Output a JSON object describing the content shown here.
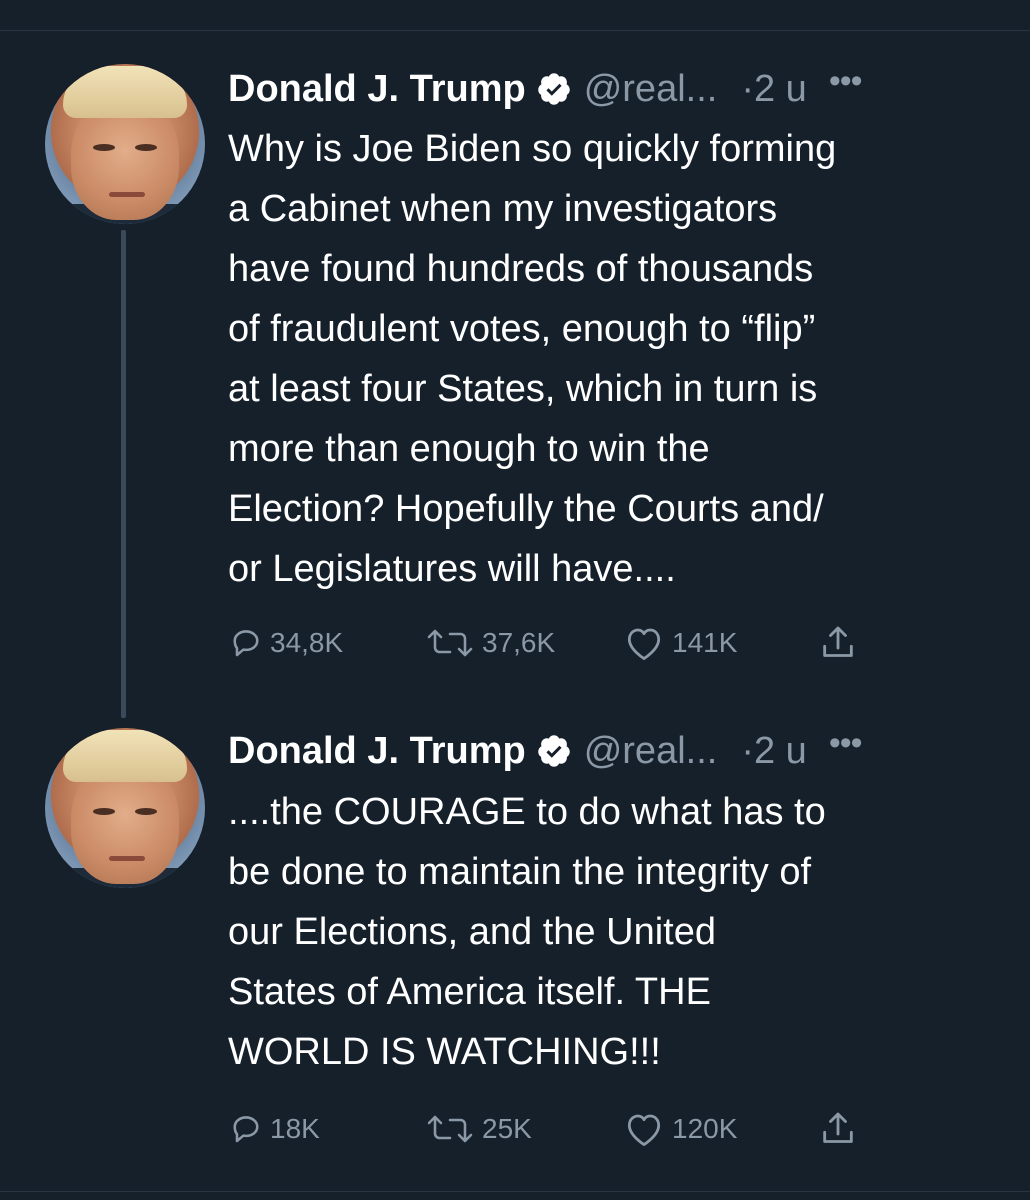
{
  "tweets": [
    {
      "author": "Donald J. Trump",
      "handle": "@real...",
      "time": "·2 u",
      "more": "•••",
      "lines": [
        "Why is Joe Biden so quickly forming",
        "a Cabinet when my investigators",
        "have found hundreds of thousands",
        "of fraudulent votes, enough to “flip”",
        "at least four States, which in turn is",
        "more than enough to win the",
        "Election? Hopefully the Courts and/",
        "or Legislatures will have...."
      ],
      "replies": "34,8K",
      "retweets": "37,6K",
      "likes": "141K"
    },
    {
      "author": "Donald J. Trump",
      "handle": "@real...",
      "time": "·2 u",
      "more": "•••",
      "lines": [
        "....the COURAGE to do what has to",
        "be done to maintain the integrity of",
        "our Elections,  and the United",
        "States of America itself. THE",
        "WORLD IS WATCHING!!!"
      ],
      "replies": "18K",
      "retweets": "25K",
      "likes": "120K"
    }
  ],
  "colors": {
    "background": "#15202b",
    "text": "#ffffff",
    "muted": "#8b98a5",
    "thread_line": "#3a4a5a"
  },
  "icons": [
    "verified-badge-icon",
    "more-icon",
    "reply-icon",
    "retweet-icon",
    "like-icon",
    "share-icon"
  ]
}
